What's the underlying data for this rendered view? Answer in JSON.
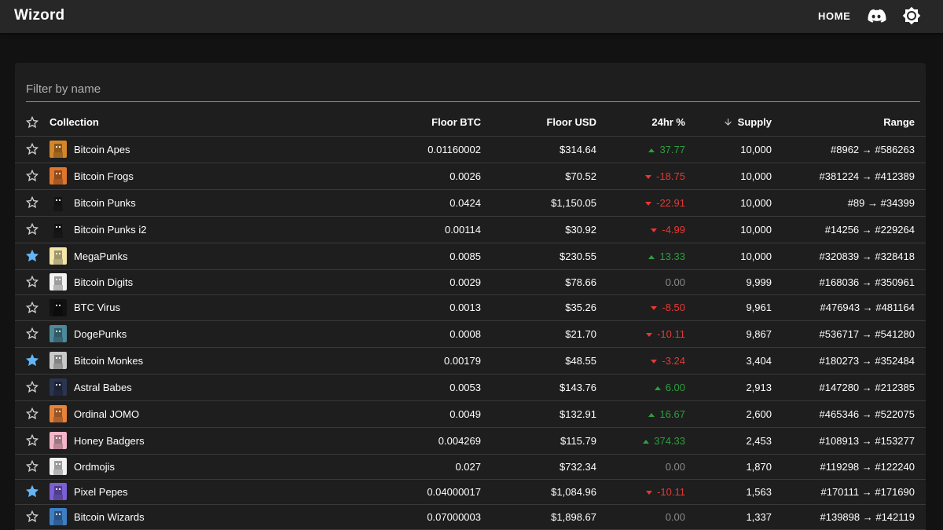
{
  "app": {
    "title": "Wizord"
  },
  "nav": {
    "home_label": "HOME"
  },
  "icons": {
    "discord": "discord-icon",
    "theme": "brightness-icon",
    "star": "star-icon",
    "sort": "arrow-down-icon"
  },
  "colors": {
    "star_active": "#64b5f6",
    "up": "#2e9e3e",
    "down": "#e53935",
    "flat": "#8a8a8a"
  },
  "filter": {
    "placeholder": "Filter by name",
    "value": ""
  },
  "table": {
    "columns": {
      "collection": "Collection",
      "floor_btc": "Floor BTC",
      "floor_usd": "Floor USD",
      "change": "24hr %",
      "supply": "Supply",
      "range": "Range"
    },
    "sort": {
      "column": "supply",
      "direction": "desc"
    },
    "rows": [
      {
        "starred": false,
        "name": "Bitcoin Apes",
        "avatar": "#d4862a",
        "floor_btc": "0.01160002",
        "floor_usd": "$314.64",
        "change": "37.77",
        "dir": "up",
        "supply": "10,000",
        "range": "#8962 → #586263"
      },
      {
        "starred": false,
        "name": "Bitcoin Frogs",
        "avatar": "#e0762c",
        "floor_btc": "0.0026",
        "floor_usd": "$70.52",
        "change": "-18.75",
        "dir": "down",
        "supply": "10,000",
        "range": "#381224 → #412389"
      },
      {
        "starred": false,
        "name": "Bitcoin Punks",
        "avatar": "#1e1e1e",
        "floor_btc": "0.0424",
        "floor_usd": "$1,150.05",
        "change": "-22.91",
        "dir": "down",
        "supply": "10,000",
        "range": "#89 → #34399"
      },
      {
        "starred": false,
        "name": "Bitcoin Punks i2",
        "avatar": "#1e1e1e",
        "floor_btc": "0.00114",
        "floor_usd": "$30.92",
        "change": "-4.99",
        "dir": "down",
        "supply": "10,000",
        "range": "#14256 → #229264"
      },
      {
        "starred": true,
        "name": "MegaPunks",
        "avatar": "#f5e6a8",
        "floor_btc": "0.0085",
        "floor_usd": "$230.55",
        "change": "13.33",
        "dir": "up",
        "supply": "10,000",
        "range": "#320839 → #328418"
      },
      {
        "starred": false,
        "name": "Bitcoin Digits",
        "avatar": "#f2f2f2",
        "floor_btc": "0.0029",
        "floor_usd": "$78.66",
        "change": "0.00",
        "dir": "flat",
        "supply": "9,999",
        "range": "#168036 → #350961"
      },
      {
        "starred": false,
        "name": "BTC Virus",
        "avatar": "#111111",
        "floor_btc": "0.0013",
        "floor_usd": "$35.26",
        "change": "-8.50",
        "dir": "down",
        "supply": "9,961",
        "range": "#476943 → #481164"
      },
      {
        "starred": false,
        "name": "DogePunks",
        "avatar": "#4c8a9a",
        "floor_btc": "0.0008",
        "floor_usd": "$21.70",
        "change": "-10.11",
        "dir": "down",
        "supply": "9,867",
        "range": "#536717 → #541280"
      },
      {
        "starred": true,
        "name": "Bitcoin Monkes",
        "avatar": "#c9c9c9",
        "floor_btc": "0.00179",
        "floor_usd": "$48.55",
        "change": "-3.24",
        "dir": "down",
        "supply": "3,404",
        "range": "#180273 → #352484"
      },
      {
        "starred": false,
        "name": "Astral Babes",
        "avatar": "#2a3550",
        "floor_btc": "0.0053",
        "floor_usd": "$143.76",
        "change": "6.00",
        "dir": "up",
        "supply": "2,913",
        "range": "#147280 → #212385"
      },
      {
        "starred": false,
        "name": "Ordinal JOMO",
        "avatar": "#e8823a",
        "floor_btc": "0.0049",
        "floor_usd": "$132.91",
        "change": "16.67",
        "dir": "up",
        "supply": "2,600",
        "range": "#465346 → #522075"
      },
      {
        "starred": false,
        "name": "Honey Badgers",
        "avatar": "#f4b6c8",
        "floor_btc": "0.004269",
        "floor_usd": "$115.79",
        "change": "374.33",
        "dir": "up",
        "supply": "2,453",
        "range": "#108913 → #153277"
      },
      {
        "starred": false,
        "name": "Ordmojis",
        "avatar": "#f2f2f2",
        "floor_btc": "0.027",
        "floor_usd": "$732.34",
        "change": "0.00",
        "dir": "flat",
        "supply": "1,870",
        "range": "#119298 → #122240"
      },
      {
        "starred": true,
        "name": "Pixel Pepes",
        "avatar": "#7b5fd4",
        "floor_btc": "0.04000017",
        "floor_usd": "$1,084.96",
        "change": "-10.11",
        "dir": "down",
        "supply": "1,563",
        "range": "#170111 → #171690"
      },
      {
        "starred": false,
        "name": "Bitcoin Wizards",
        "avatar": "#3e7fc4",
        "floor_btc": "0.07000003",
        "floor_usd": "$1,898.67",
        "change": "0.00",
        "dir": "flat",
        "supply": "1,337",
        "range": "#139898 → #142119"
      }
    ]
  }
}
